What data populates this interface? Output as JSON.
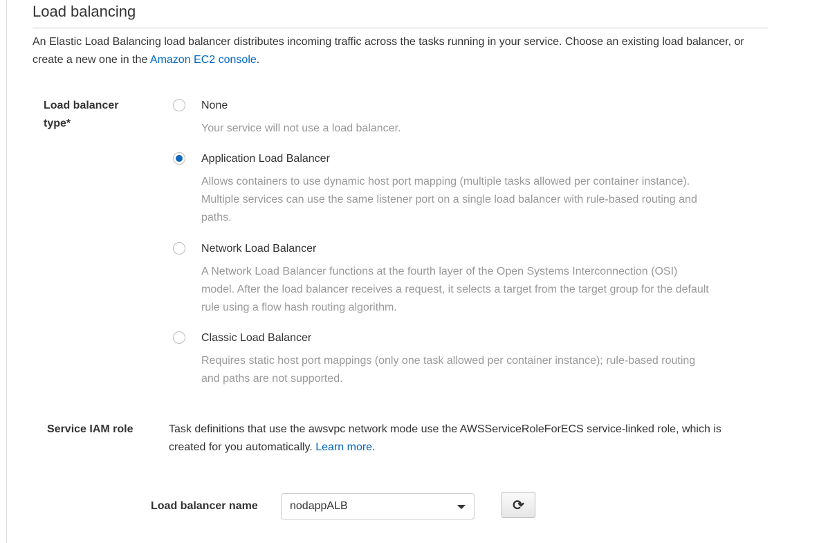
{
  "section": {
    "title": "Load balancing",
    "intro": "An Elastic Load Balancing load balancer distributes incoming traffic across the tasks running in your service. Choose an existing load balancer, or create a new one in the ",
    "intro_link": "Amazon EC2 console",
    "intro_end": "."
  },
  "lb_type": {
    "label": "Load balancer type*",
    "options": [
      {
        "title": "None",
        "desc": "Your service will not use a load balancer.",
        "selected": false
      },
      {
        "title": "Application Load Balancer",
        "desc": "Allows containers to use dynamic host port mapping (multiple tasks allowed per container instance). Multiple services can use the same listener port on a single load balancer with rule-based routing and paths.",
        "selected": true
      },
      {
        "title": "Network Load Balancer",
        "desc": "A Network Load Balancer functions at the fourth layer of the Open Systems Interconnection (OSI) model. After the load balancer receives a request, it selects a target from the target group for the default rule using a flow hash routing algorithm.",
        "selected": false
      },
      {
        "title": "Classic Load Balancer",
        "desc": "Requires static host port mappings (only one task allowed per container instance); rule-based routing and paths are not supported.",
        "selected": false
      }
    ]
  },
  "iam": {
    "label": "Service IAM role",
    "text": "Task definitions that use the awsvpc network mode use the AWSServiceRoleForECS service-linked role, which is created for you automatically. ",
    "link": "Learn more",
    "end": "."
  },
  "lb_name": {
    "label": "Load balancer name",
    "value": "nodappALB",
    "refresh_icon": "refresh-icon"
  },
  "colors": {
    "accent": "#1166bb",
    "link": "#0066c0"
  }
}
